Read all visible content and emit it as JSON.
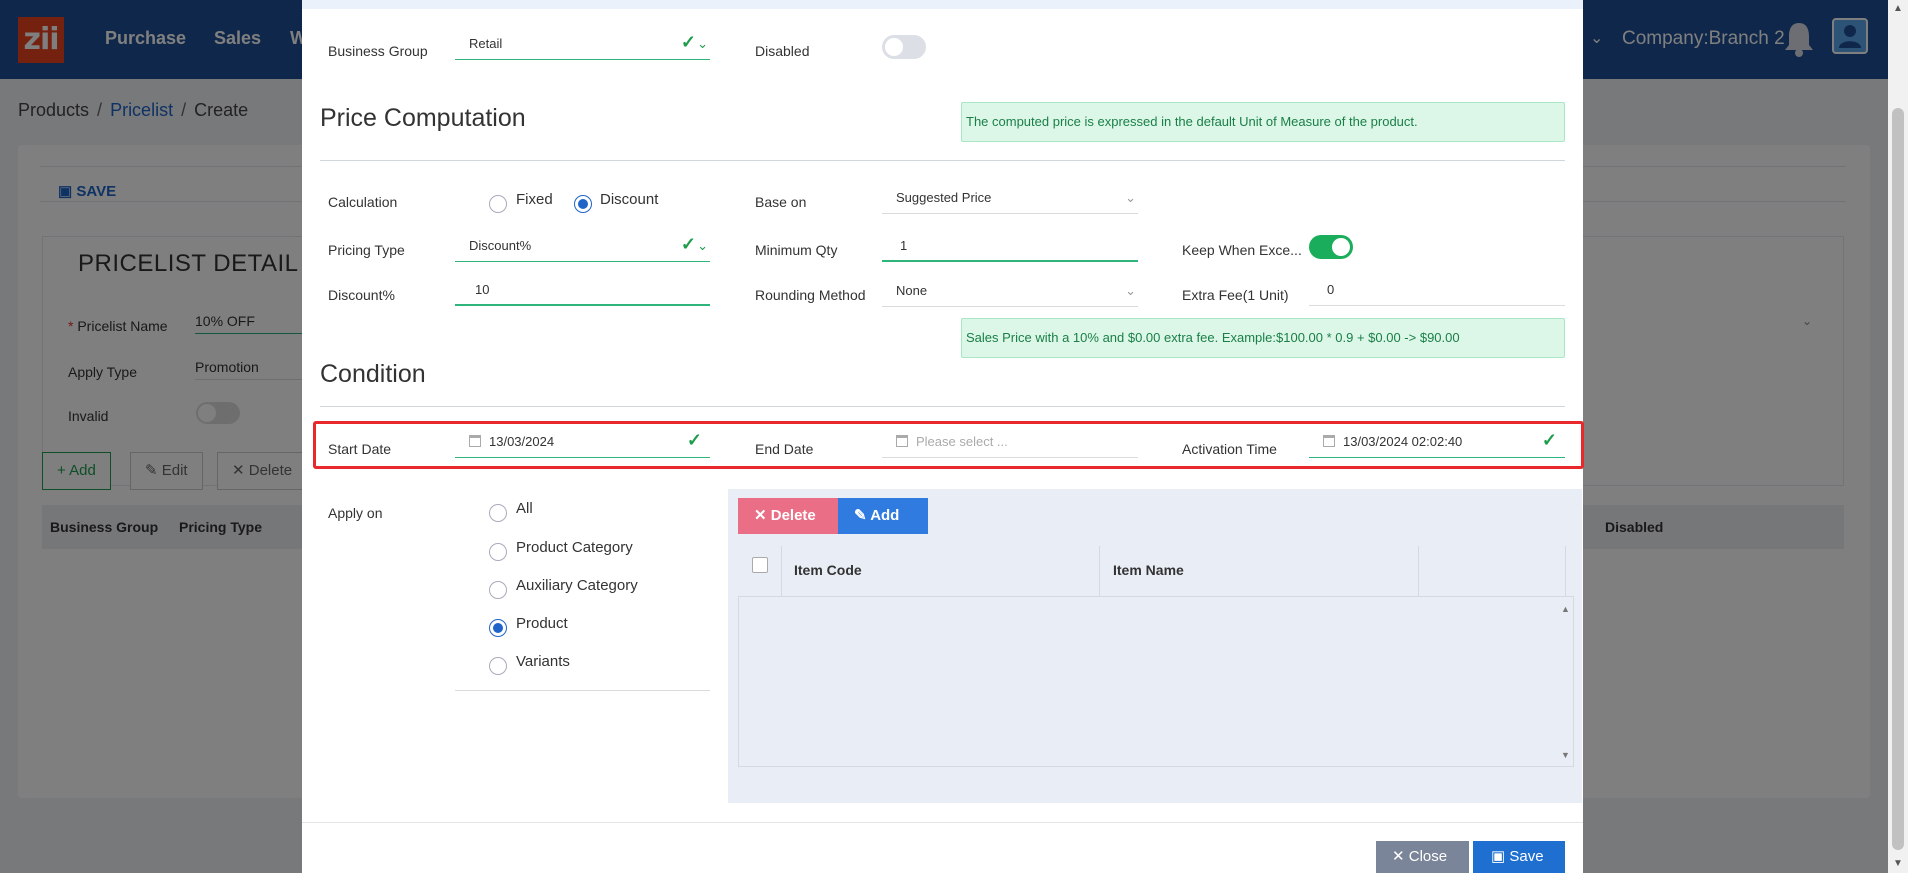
{
  "background": {
    "logo": "zii",
    "nav": [
      "Purchase",
      "Sales",
      "W"
    ],
    "company": "Company:Branch 2",
    "breadcrumb": [
      "Products",
      "Pricelist",
      "Create"
    ],
    "save": "SAVE",
    "detail_title": "PRICELIST DETAIL",
    "pricelist_name_label": "Pricelist Name",
    "pricelist_name_value": "10% OFF",
    "apply_type_label": "Apply Type",
    "apply_type_value": "Promotion",
    "invalid_label": "Invalid",
    "btn_add": "Add",
    "btn_edit": "Edit",
    "btn_delete": "Delete",
    "table_headers": [
      "Business Group",
      "Pricing Type",
      "Disabled"
    ]
  },
  "modal": {
    "business_group_label": "Business Group",
    "business_group_value": "Retail",
    "disabled_label": "Disabled",
    "price_computation_title": "Price Computation",
    "price_info": "The computed price is expressed in the default Unit of Measure of the product.",
    "calculation_label": "Calculation",
    "calc_fixed": "Fixed",
    "calc_discount": "Discount",
    "base_on_label": "Base on",
    "base_on_value": "Suggested Price",
    "pricing_type_label": "Pricing Type",
    "pricing_type_value": "Discount%",
    "min_qty_label": "Minimum Qty",
    "min_qty_value": "1",
    "keep_label": "Keep When Exce...",
    "discount_label": "Discount%",
    "discount_value": "10",
    "rounding_label": "Rounding Method",
    "rounding_value": "None",
    "extra_fee_label": "Extra Fee(1 Unit)",
    "extra_fee_value": "0",
    "sales_info": "Sales Price with a 10% and $0.00 extra fee. Example:$100.00 * 0.9 + $0.00 -> $90.00",
    "condition_title": "Condition",
    "start_date_label": "Start Date",
    "start_date_value": "13/03/2024",
    "end_date_label": "End Date",
    "end_date_placeholder": "Please select ...",
    "activation_label": "Activation Time",
    "activation_value": "13/03/2024 02:02:40",
    "apply_on_label": "Apply on",
    "apply_options": [
      "All",
      "Product Category",
      "Auxiliary Category",
      "Product",
      "Variants"
    ],
    "apply_selected": "Product",
    "delete_btn": "Delete",
    "add_btn": "Add",
    "grid_headers": [
      "Item Code",
      "Item Name"
    ],
    "close_btn": "Close",
    "save_btn": "Save"
  },
  "colors": {
    "nav_bg": "#1f4e96",
    "accent": "#1f64c8",
    "success": "#1aae5c",
    "highlight": "#e8282b"
  }
}
